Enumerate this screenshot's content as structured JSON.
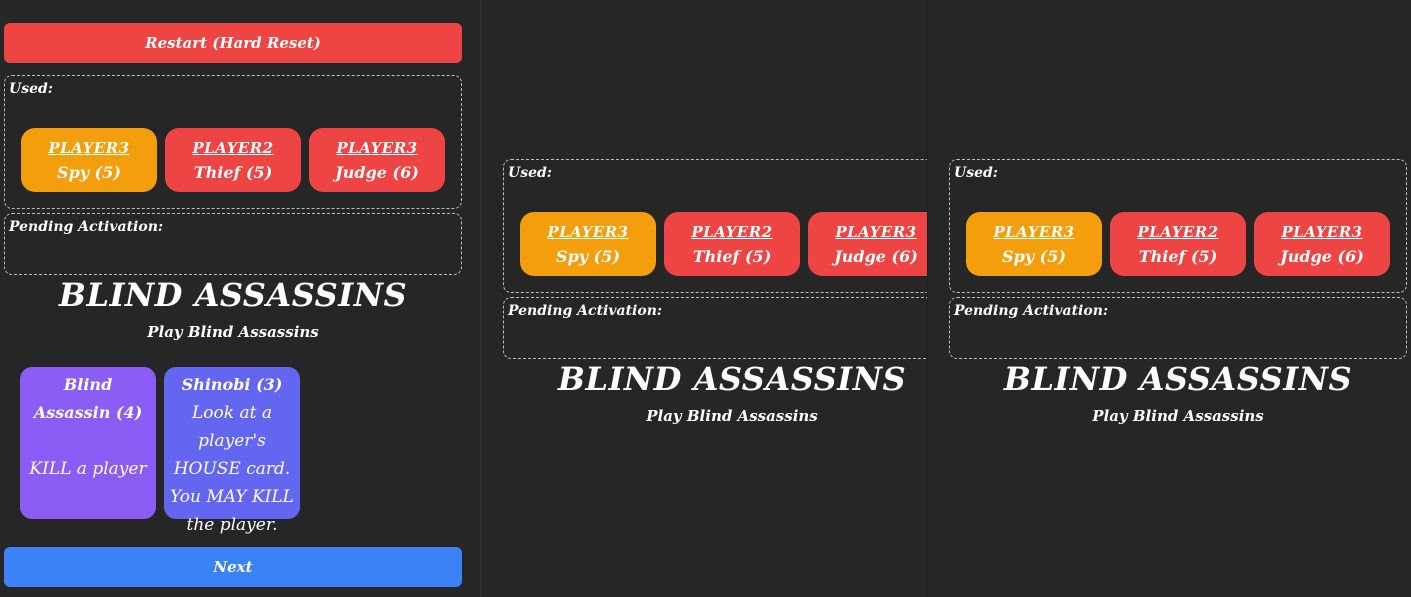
{
  "controls": {
    "restart_label": "Restart (Hard Reset)",
    "next_label": "Next"
  },
  "zones": {
    "used_label": "Used:",
    "pending_label": "Pending Activation:"
  },
  "used_cards": [
    {
      "owner": "PLAYER3",
      "name": "Spy (5)",
      "color": "#f59e0b"
    },
    {
      "owner": "PLAYER2",
      "name": "Thief (5)",
      "color": "#ef4444"
    },
    {
      "owner": "PLAYER3",
      "name": "Judge (6)",
      "color": "#ef4444"
    }
  ],
  "game": {
    "title": "BLIND ASSASSINS",
    "subtitle": "Play Blind Assassins"
  },
  "hand": [
    {
      "title": "Blind Assassin (4)",
      "description": "KILL a player",
      "color": "#8b5cf6"
    },
    {
      "title": "Shinobi (3)",
      "description": "Look at a player's HOUSE card. You MAY KILL the player.",
      "color": "#6366f1"
    }
  ],
  "colors": {
    "background": "#262626",
    "restart": "#ef4444",
    "next": "#3b82f6"
  }
}
